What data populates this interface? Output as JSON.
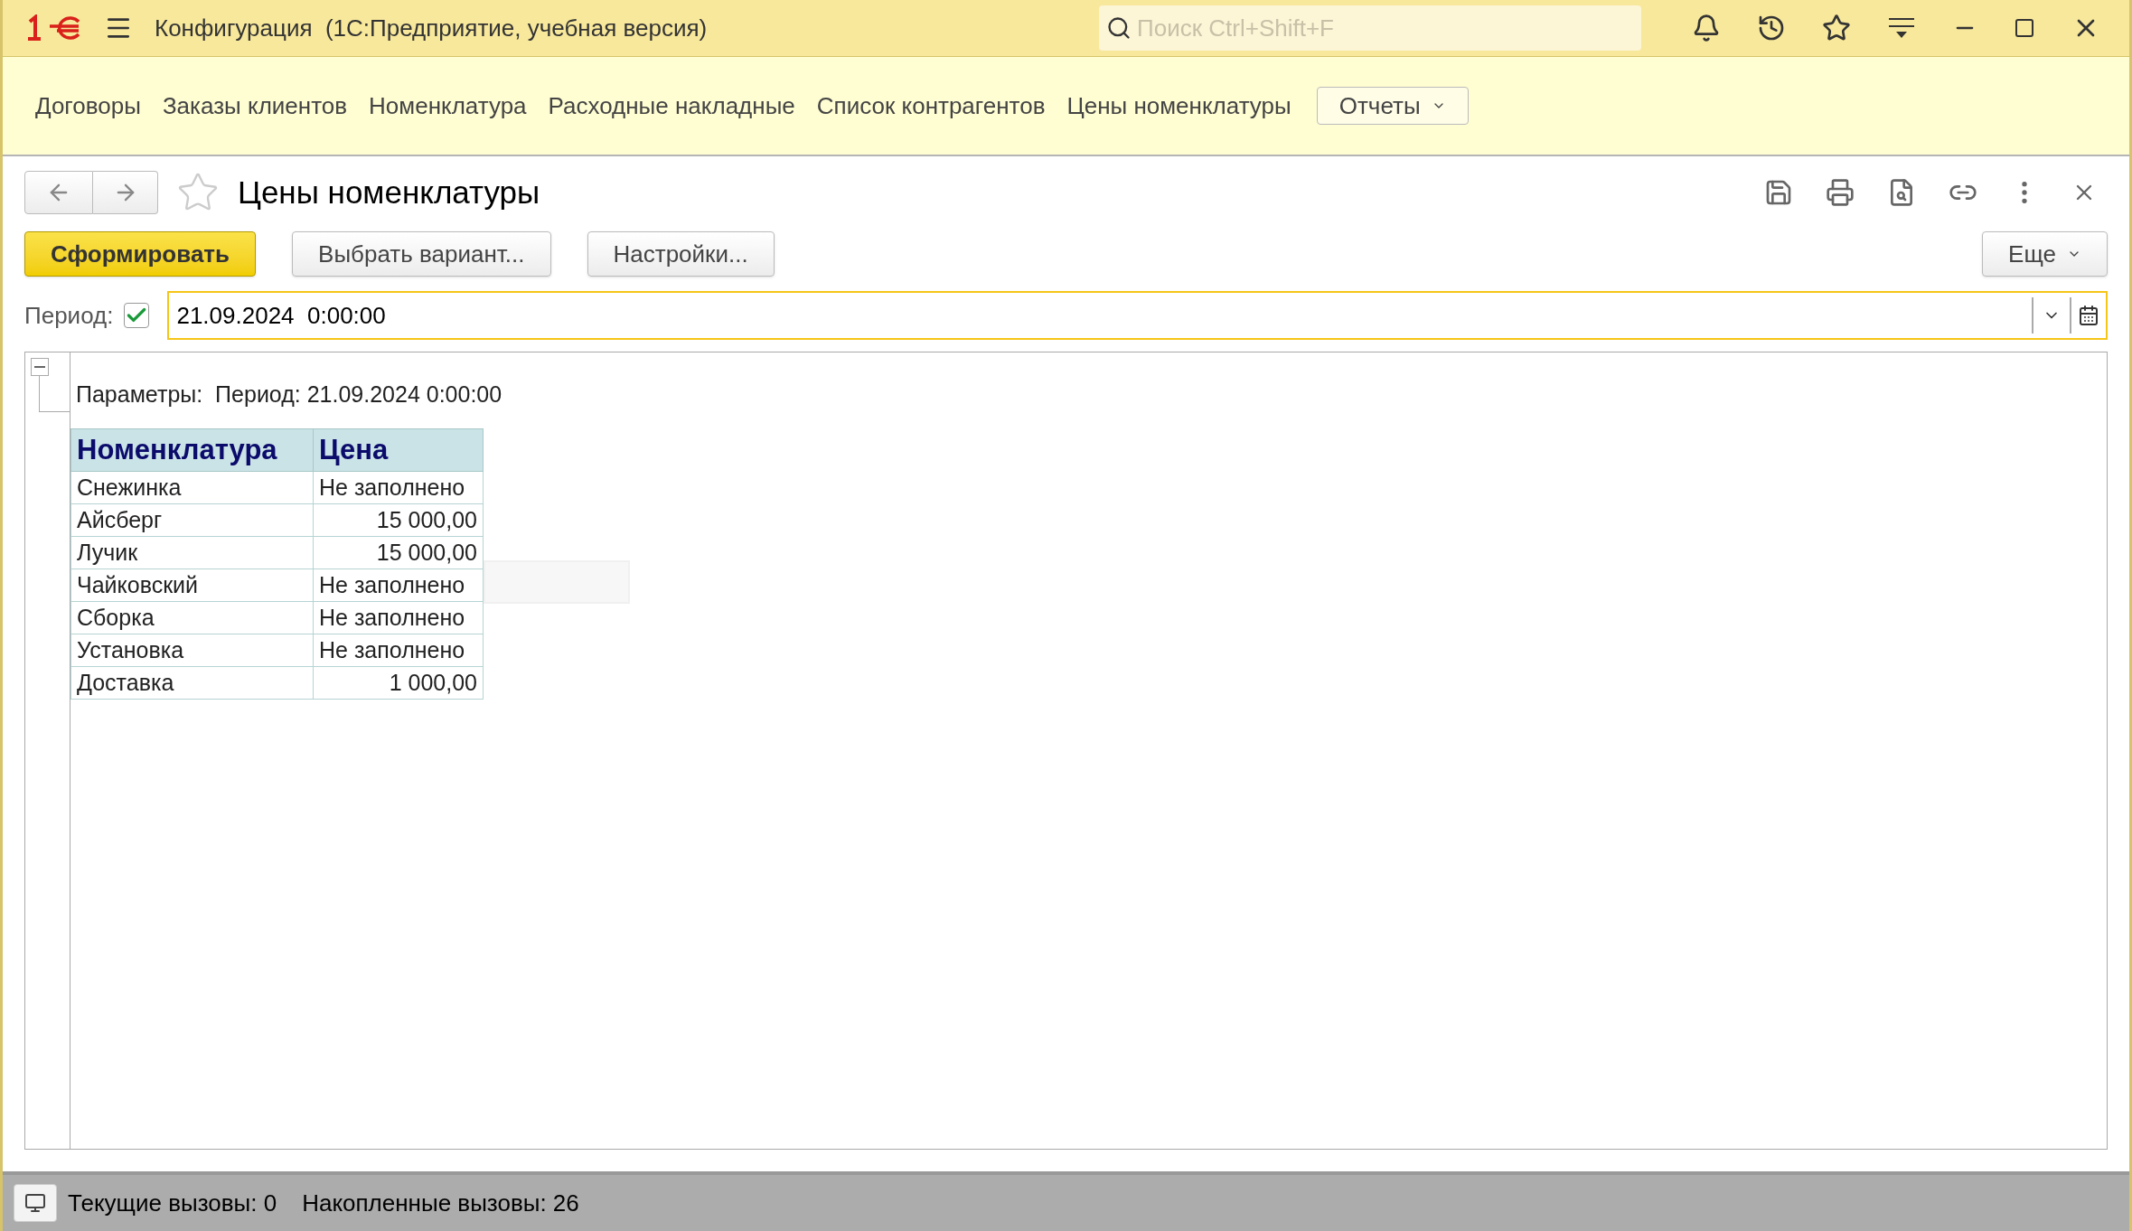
{
  "window": {
    "title": "Конфигурация  (1С:Предприятие, учебная версия)"
  },
  "search": {
    "placeholder": "Поиск Ctrl+Shift+F"
  },
  "sections": [
    {
      "label": "Договоры"
    },
    {
      "label": "Заказы клиентов"
    },
    {
      "label": "Номенклатура"
    },
    {
      "label": "Расходные накладные"
    },
    {
      "label": "Список контрагентов"
    },
    {
      "label": "Цены номенклатуры"
    }
  ],
  "sections_menu": {
    "label": "Отчеты"
  },
  "form": {
    "title": "Цены номенклатуры",
    "buttons": [
      {
        "label": "Сформировать",
        "kind": "default"
      },
      {
        "label": "Выбрать вариант...",
        "kind": "normal"
      },
      {
        "label": "Настройки...",
        "kind": "normal"
      }
    ],
    "more": "Еще",
    "period": {
      "label": "Период:",
      "checked": true,
      "value": "21.09.2024  0:00:00"
    }
  },
  "report": {
    "parameters": "Параметры:  Период: 21.09.2024 0:00:00",
    "columns": [
      "Номенклатура",
      "Цена"
    ],
    "rows": [
      {
        "item": "Снежинка",
        "price": "Не заполнено",
        "kind": "text"
      },
      {
        "item": "Айсберг",
        "price": "15 000,00",
        "kind": "number"
      },
      {
        "item": "Лучик",
        "price": "15 000,00",
        "kind": "number"
      },
      {
        "item": "Чайковский",
        "price": "Не заполнено",
        "kind": "text"
      },
      {
        "item": "Сборка",
        "price": "Не заполнено",
        "kind": "text"
      },
      {
        "item": "Установка",
        "price": "Не заполнено",
        "kind": "text"
      },
      {
        "item": "Доставка",
        "price": "1 000,00",
        "kind": "number"
      }
    ]
  },
  "status_bar": {
    "current": "Текущие вызовы: 0",
    "accumulated": "Накопленные вызовы: 26"
  }
}
